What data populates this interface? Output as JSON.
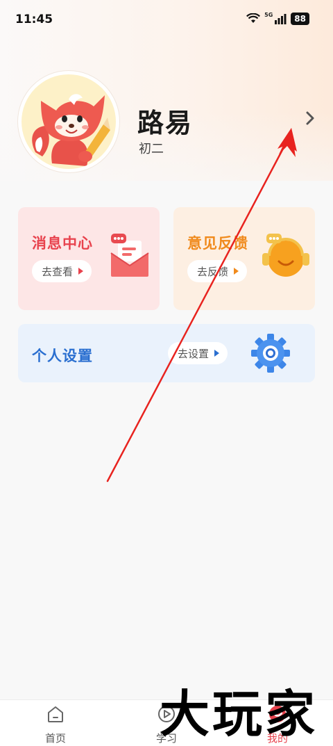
{
  "status_bar": {
    "time": "11:45",
    "network": "5G",
    "battery": "88"
  },
  "profile": {
    "name": "路易",
    "grade": "初二"
  },
  "cards": {
    "messages": {
      "title": "消息中心",
      "action": "去查看"
    },
    "feedback": {
      "title": "意见反馈",
      "action": "去反馈"
    },
    "settings": {
      "title": "个人设置",
      "action": "去设置"
    }
  },
  "bottom_nav": {
    "items": [
      {
        "label": "首页",
        "icon": "home-icon"
      },
      {
        "label": "学习",
        "icon": "play-circle-icon"
      },
      {
        "label": "我的",
        "icon": "mine-icon",
        "active": true
      }
    ]
  },
  "watermark": "大玩家",
  "colors": {
    "messages_accent": "#e8424d",
    "feedback_accent": "#f08a1c",
    "settings_accent": "#2a6fd0",
    "annotation_arrow": "#e8231f"
  }
}
